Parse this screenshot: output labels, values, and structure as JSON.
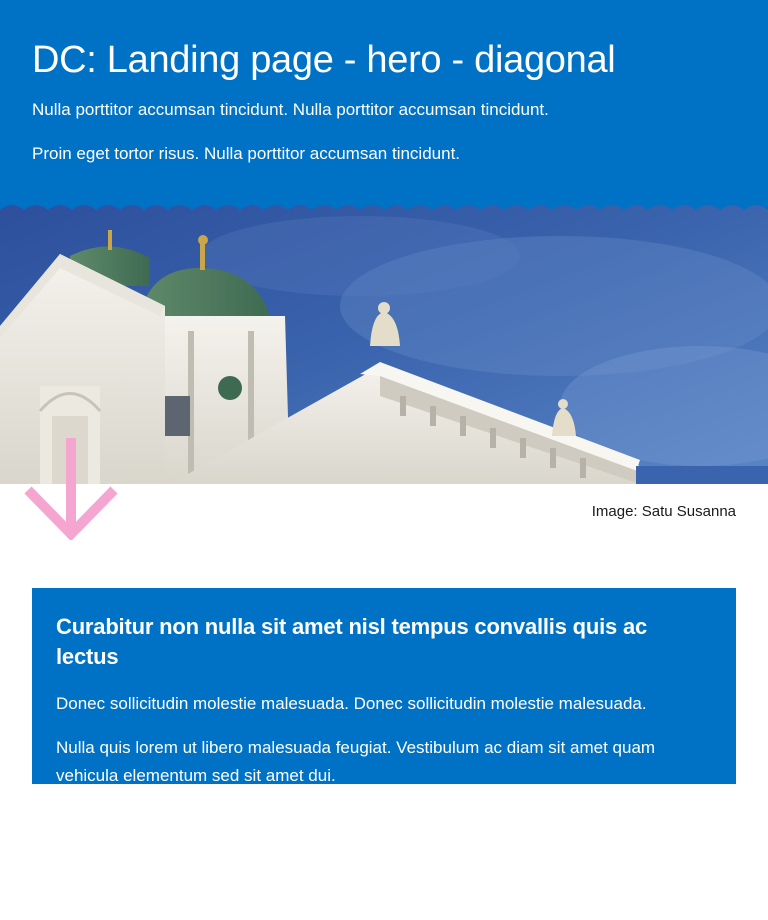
{
  "hero": {
    "title": "DC: Landing page - hero - diagonal",
    "paragraph_1": "Nulla porttitor accumsan tincidunt. Nulla porttitor accumsan tincidunt.",
    "paragraph_2": "Proin eget tortor risus. Nulla porttitor accumsan tincidunt.",
    "background_color": "#0072c6"
  },
  "image": {
    "credit": "Image: Satu Susanna"
  },
  "arrow": {
    "icon": "arrow-down-icon",
    "color": "#f4a6d0"
  },
  "card": {
    "title": "Curabitur non nulla sit amet nisl tempus convallis quis ac lectus",
    "paragraph_1": "Donec sollicitudin molestie malesuada. Donec sollicitudin molestie malesuada.",
    "paragraph_2": "Nulla quis lorem ut libero malesuada feugiat. Vestibulum ac diam sit amet quam vehicula elementum sed sit amet dui.",
    "background_color": "#0072c6"
  }
}
